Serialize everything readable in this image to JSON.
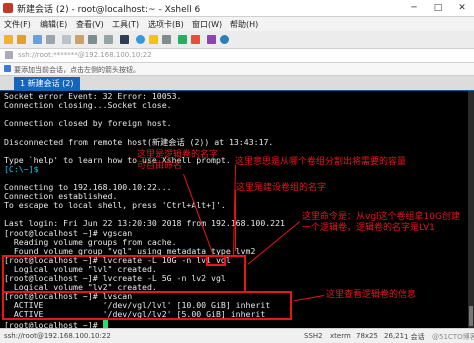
{
  "window": {
    "title": "新建会话 (2) - root@localhost:~ - Xshell 6",
    "controls": [
      "─",
      "□",
      "✕"
    ]
  },
  "menubar": {
    "items": [
      "文件(F)",
      "编辑(E)",
      "查看(V)",
      "工具(T)",
      "选项卡(B)",
      "窗口(W)",
      "帮助(H)"
    ]
  },
  "toolbar": {
    "icons": [
      "new-session-icon",
      "open-folder-icon",
      "link-icon",
      "disconnect-icon",
      "copy-icon",
      "paste-icon",
      "find-icon",
      "print-icon",
      "font-icon",
      "globe-icon",
      "lock-icon",
      "keyboard-icon",
      "transfer-icon",
      "xftp-icon",
      "settings-icon",
      "help-icon"
    ]
  },
  "addressbar": {
    "value": "ssh://root:*******@192.168.100.10:22"
  },
  "hintbar": {
    "text": "要添加当前会话，点击左侧的箭头按钮。"
  },
  "tabs": [
    {
      "label": "1 新建会话 (2)"
    }
  ],
  "terminal": {
    "lines": [
      "Socket error Event: 32 Error: 10053.",
      "Connection closing...Socket close.",
      "",
      "Connection closed by foreign host.",
      "",
      "Disconnected from remote host(新建会话 (2)) at 13:43:17.",
      "",
      "Type `help' to learn how to use Xshell prompt.",
      "[C:\\~]$",
      "",
      "Connecting to 192.168.100.10:22...",
      "Connection established.",
      "To escape to local shell, press 'Ctrl+Alt+]'.",
      "",
      "Last login: Fri Jun 22 13:20:30 2018 from 192.168.100.221",
      "[root@localhost ~]# vgscan",
      "  Reading volume groups from cache.",
      "  Found volume group \"vgl\" using metadata type lvm2",
      "[root@localhost ~]# lvcreate -L 10G -n lvl vgl",
      "  Logical volume \"lvl\" created.",
      "[root@localhost ~]# lvcreate -L 5G -n lv2 vgl",
      "  Logical volume \"lv2\" created.",
      "[root@localhost ~]# lvscan",
      "  ACTIVE            '/dev/vgl/lvl' [10.00 GiB] inherit",
      "  ACTIVE            '/dev/vgl/lv2' [5.00 GiB] inherit",
      "[root@localhost ~]# "
    ],
    "prompt_color": "#00d0ff"
  },
  "annotations": {
    "lv_name": "这里是逻辑卷的名字\n可自由命名",
    "vg_source": "这里意思是从哪个卷组分割出将需要的容量",
    "vg_name": "这里是建设卷组的名字",
    "command_note": "这里命令是：从vgl这个卷组拿10G创建一个逻辑卷，逻辑卷的名字是LV1",
    "lvscan_note": "这里查看逻辑卷的信息"
  },
  "statusbar": {
    "left": "ssh://root@192.168.100.10:22",
    "items": [
      "SSH2",
      "xterm",
      "78x25",
      "26,21",
      "1 会话"
    ],
    "watermark": "@51CTO博客"
  },
  "colors": {
    "annotation": "#e8141b",
    "tab_active": "#1565c0",
    "terminal_bg": "#000000"
  }
}
